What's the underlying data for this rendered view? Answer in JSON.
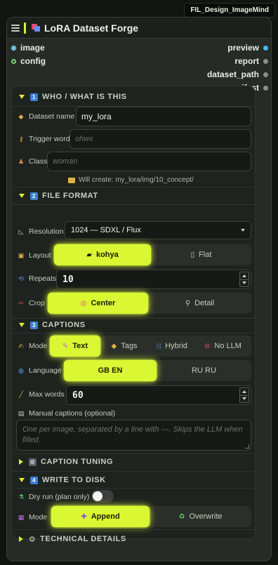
{
  "badge": "FIL_Design_ImageMind",
  "node": {
    "title": "LoRA Dataset Forge"
  },
  "inputs": [
    {
      "label": "image",
      "color": "#7ab8d8"
    },
    {
      "label": "config",
      "color": "#7ad87a"
    }
  ],
  "outputs": [
    {
      "label": "preview",
      "color": "#4fb4ff"
    },
    {
      "label": "report",
      "color": "#8a8f88"
    },
    {
      "label": "dataset_path",
      "color": "#8a8f88"
    },
    {
      "label": "manifest",
      "color": "#8a8f88"
    }
  ],
  "sections": {
    "who": {
      "num": "1",
      "title": "WHO / WHAT IS THIS"
    },
    "format": {
      "num": "2",
      "title": "FILE FORMAT"
    },
    "captions": {
      "num": "3",
      "title": "CAPTIONS"
    },
    "tuning": {
      "title": "CAPTION TUNING"
    },
    "write": {
      "num": "4",
      "title": "WRITE TO DISK"
    },
    "technical": {
      "title": "TECHNICAL DETAILS"
    }
  },
  "fields": {
    "dataset_name": {
      "label": "Dataset name",
      "value": "my_lora"
    },
    "trigger_word": {
      "label": "Trigger word",
      "placeholder": "ohwx"
    },
    "class": {
      "label": "Class",
      "placeholder": "woman"
    },
    "will_create": "Will create: my_lora/img/10_concept/",
    "resolution": {
      "label": "Resolution",
      "value": "1024 — SDXL / Flux"
    },
    "layout": {
      "label": "Layout",
      "options": [
        "kohya",
        "Flat"
      ],
      "selected": "kohya"
    },
    "repeats": {
      "label": "Repeats",
      "value": "10"
    },
    "crop": {
      "label": "Crop",
      "options": [
        "Center",
        "Detail"
      ],
      "selected": "Center"
    },
    "mode": {
      "label": "Mode",
      "options": [
        "Text",
        "Tags",
        "Hybrid",
        "No LLM"
      ],
      "selected": "Text"
    },
    "language": {
      "label": "Language",
      "options": [
        "GB EN",
        "RU RU"
      ],
      "selected": "GB EN"
    },
    "max_words": {
      "label": "Max words",
      "value": "60"
    },
    "manual_captions": {
      "label": "Manual captions (optional)",
      "placeholder": "One per image, separated by a line with ---. Skips the LLM when filled."
    },
    "dry_run": {
      "label": "Dry run (plan only)",
      "on": false
    },
    "write_mode": {
      "label": "Mode",
      "options": [
        "Append",
        "Overwrite"
      ],
      "selected": "Append"
    }
  },
  "colors": {
    "accent": "#d9f733",
    "number_badge": "#3d7fd8",
    "panel": "#1f231f"
  }
}
